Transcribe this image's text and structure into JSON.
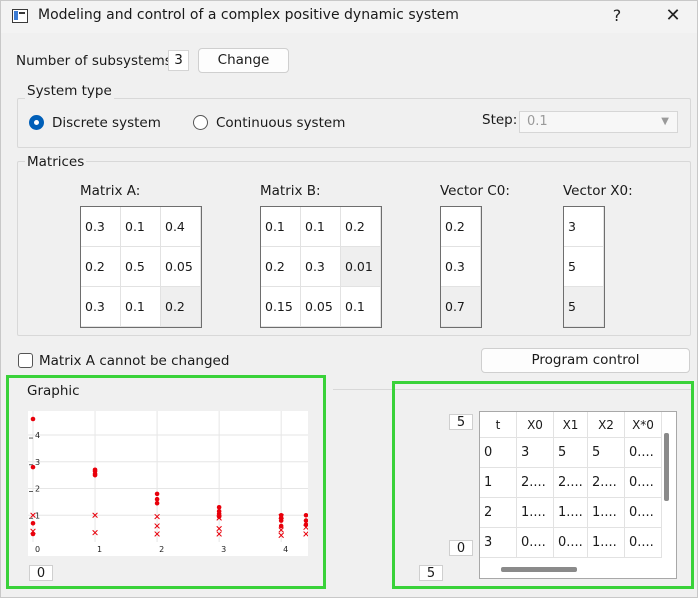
{
  "window": {
    "title": "Modeling and control of a complex positive dynamic system",
    "help": "?",
    "close": "✕"
  },
  "subsystems": {
    "label": "Number of subsystems:",
    "value": "3",
    "change_label": "Change"
  },
  "system_type": {
    "title": "System type",
    "discrete_label": "Discrete system",
    "continuous_label": "Continuous system",
    "selected": "discrete",
    "step_label": "Step:",
    "step_value": "0.1"
  },
  "matrices": {
    "title": "Matrices",
    "a_label": "Matrix A:",
    "b_label": "Matrix B:",
    "c0_label": "Vector C0:",
    "x0_label": "Vector X0:",
    "A": [
      [
        "0.3",
        "0.1",
        "0.4"
      ],
      [
        "0.2",
        "0.5",
        "0.05"
      ],
      [
        "0.3",
        "0.1",
        "0.2"
      ]
    ],
    "B": [
      [
        "0.1",
        "0.1",
        "0.2"
      ],
      [
        "0.2",
        "0.3",
        "0.01"
      ],
      [
        "0.15",
        "0.05",
        "0.1"
      ]
    ],
    "C0": [
      "0.2",
      "0.3",
      "0.7"
    ],
    "X0": [
      "3",
      "5",
      "5"
    ]
  },
  "lock_label": "Matrix A cannot be changed",
  "program_control_label": "Program control",
  "graphic": {
    "title": "Graphic",
    "spin_value": "0",
    "colors": {
      "series": "#e8000b",
      "grid": "#e6e6e6"
    },
    "y_ticks": [
      "1",
      "2",
      "3",
      "4"
    ],
    "x_ticks": [
      "0",
      "1",
      "2",
      "3",
      "4"
    ]
  },
  "chart_data": {
    "type": "scatter",
    "title": "",
    "xlabel": "",
    "ylabel": "",
    "xlim": [
      0,
      4.4
    ],
    "ylim": [
      0,
      4.6
    ],
    "x_ticks": [
      0,
      1,
      2,
      3,
      4
    ],
    "y_ticks": [
      1,
      2,
      3,
      4
    ],
    "grid": true,
    "series": [
      {
        "marker": "dot",
        "points": [
          [
            0,
            0.3
          ],
          [
            0,
            0.7
          ],
          [
            0,
            2.8
          ],
          [
            0,
            4.6
          ],
          [
            1,
            2.5
          ],
          [
            1,
            2.55
          ],
          [
            1,
            2.65
          ],
          [
            1,
            2.7
          ],
          [
            2,
            1.45
          ],
          [
            2,
            1.6
          ],
          [
            2,
            1.8
          ],
          [
            3,
            1.05
          ],
          [
            3,
            1.15
          ],
          [
            3,
            1.3
          ],
          [
            3,
            0.95
          ],
          [
            4,
            0.8
          ],
          [
            4,
            0.9
          ],
          [
            4,
            1.0
          ],
          [
            4,
            0.6
          ],
          [
            4.4,
            0.65
          ],
          [
            4.4,
            0.8
          ],
          [
            4.4,
            1.0
          ]
        ]
      },
      {
        "marker": "x",
        "points": [
          [
            0,
            0.4
          ],
          [
            0,
            1.0
          ],
          [
            1,
            0.35
          ],
          [
            1,
            1.0
          ],
          [
            2,
            0.3
          ],
          [
            2,
            0.6
          ],
          [
            2,
            0.95
          ],
          [
            3,
            0.3
          ],
          [
            3,
            0.5
          ],
          [
            3,
            0.9
          ],
          [
            4,
            0.25
          ],
          [
            4,
            0.45
          ],
          [
            4,
            0.95
          ],
          [
            4.4,
            0.3
          ],
          [
            4.4,
            0.55
          ]
        ]
      }
    ]
  },
  "table_panel": {
    "top_spin": "5",
    "mid_spin": "0",
    "bottom_spin": "5",
    "headers": [
      "t",
      "X0",
      "X1",
      "X2",
      "X*0"
    ],
    "rows": [
      [
        "0",
        "3",
        "5",
        "5",
        "0...."
      ],
      [
        "1",
        "2....",
        "2....",
        "2....",
        "0...."
      ],
      [
        "2",
        "1....",
        "1....",
        "1....",
        "0...."
      ],
      [
        "3",
        "0....",
        "0....",
        "1....",
        "0...."
      ]
    ]
  }
}
